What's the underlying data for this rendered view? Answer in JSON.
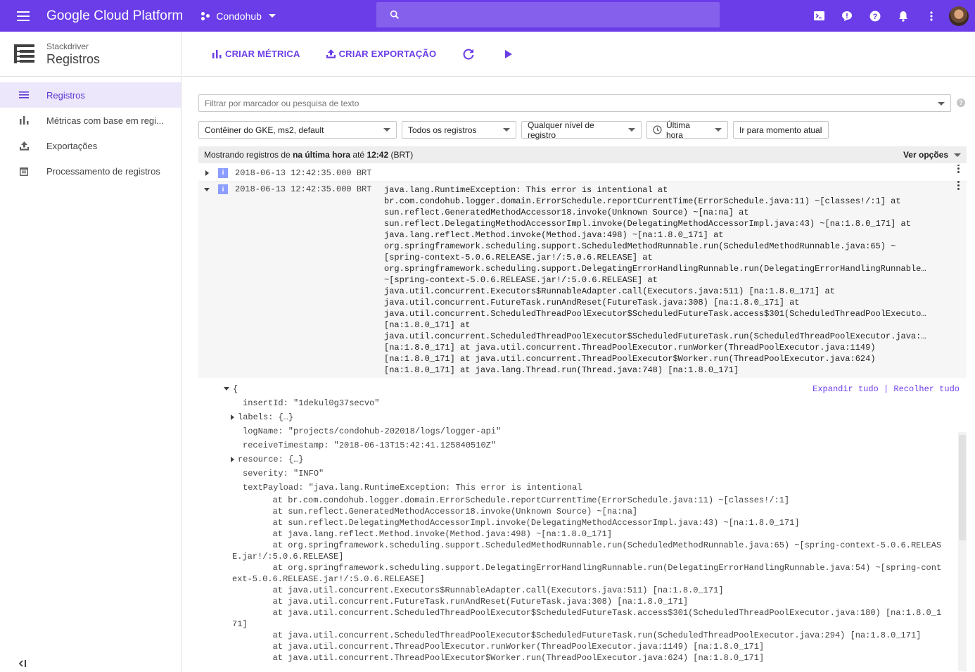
{
  "topbar": {
    "brand": "Google Cloud Platform",
    "project": "Condohub",
    "search_placeholder": ""
  },
  "sidebar": {
    "product": "Stackdriver",
    "section": "Registros",
    "items": [
      {
        "label": "Registros",
        "icon": "list-icon",
        "active": true
      },
      {
        "label": "Métricas com base em regi...",
        "icon": "bar-chart-icon",
        "active": false
      },
      {
        "label": "Exportações",
        "icon": "upload-icon",
        "active": false
      },
      {
        "label": "Processamento de registros",
        "icon": "calendar-icon",
        "active": false
      }
    ],
    "collapse_label": "<|"
  },
  "actions": {
    "create_metric": "CRIAR MÉTRICA",
    "create_export": "CRIAR EXPORTAÇÃO"
  },
  "filter": {
    "placeholder": "Filtrar por marcador ou pesquisa de texto",
    "resource": "Contêiner do GKE, ms2, default",
    "logs": "Todos os registros",
    "level": "Qualquer nível de registro",
    "time": "Última hora",
    "jump_now": "Ir para momento atual"
  },
  "status": {
    "prefix": "Mostrando registros de ",
    "range": "na última hora",
    "mid": " até ",
    "time": "12:42",
    "suffix": " (BRT)",
    "options": "Ver opções"
  },
  "entries": [
    {
      "severity": "i",
      "timestamp": "2018-06-13 12:42:35.000 BRT"
    },
    {
      "severity": "i",
      "timestamp": "2018-06-13 12:42:35.000 BRT",
      "message_lines": [
        "java.lang.RuntimeException: This error is intentional at",
        "br.com.condohub.logger.domain.ErrorSchedule.reportCurrentTime(ErrorSchedule.java:11) ~[classes!/:1] at",
        "sun.reflect.GeneratedMethodAccessor18.invoke(Unknown Source) ~[na:na] at",
        "sun.reflect.DelegatingMethodAccessorImpl.invoke(DelegatingMethodAccessorImpl.java:43) ~[na:1.8.0_171] at",
        "java.lang.reflect.Method.invoke(Method.java:498) ~[na:1.8.0_171] at",
        "org.springframework.scheduling.support.ScheduledMethodRunnable.run(ScheduledMethodRunnable.java:65) ~",
        "[spring-context-5.0.6.RELEASE.jar!/:5.0.6.RELEASE] at",
        "org.springframework.scheduling.support.DelegatingErrorHandlingRunnable.run(DelegatingErrorHandlingRunnable…",
        "~[spring-context-5.0.6.RELEASE.jar!/:5.0.6.RELEASE] at",
        "java.util.concurrent.Executors$RunnableAdapter.call(Executors.java:511) [na:1.8.0_171] at",
        "java.util.concurrent.FutureTask.runAndReset(FutureTask.java:308) [na:1.8.0_171] at",
        "java.util.concurrent.ScheduledThreadPoolExecutor$ScheduledFutureTask.access$301(ScheduledThreadPoolExecuto…",
        "[na:1.8.0_171] at",
        "java.util.concurrent.ScheduledThreadPoolExecutor$ScheduledFutureTask.run(ScheduledThreadPoolExecutor.java:…",
        "[na:1.8.0_171] at java.util.concurrent.ThreadPoolExecutor.runWorker(ThreadPoolExecutor.java:1149)",
        "[na:1.8.0_171] at java.util.concurrent.ThreadPoolExecutor$Worker.run(ThreadPoolExecutor.java:624)",
        "[na:1.8.0_171] at java.lang.Thread.run(Thread.java:748) [na:1.8.0_171]"
      ]
    }
  ],
  "json_view": {
    "open": "{",
    "expand_all": "Expandir tudo",
    "separator": "|",
    "collapse_all": "Recolher tudo",
    "insertId": "insertId: \"1dekul0g37secvo\"",
    "labels": "labels: {…}",
    "logName": "logName: \"projects/condohub-202018/logs/logger-api\"",
    "receiveTimestamp": "receiveTimestamp: \"2018-06-13T15:42:41.125840510Z\"",
    "resource": "resource: {…}",
    "severity": "severity: \"INFO\"",
    "textPayload": "textPayload: \"java.lang.RuntimeException: This error is intentional",
    "trace_lines": [
      "        at br.com.condohub.logger.domain.ErrorSchedule.reportCurrentTime(ErrorSchedule.java:11) ~[classes!/:1]",
      "        at sun.reflect.GeneratedMethodAccessor18.invoke(Unknown Source) ~[na:na]",
      "        at sun.reflect.DelegatingMethodAccessorImpl.invoke(DelegatingMethodAccessorImpl.java:43) ~[na:1.8.0_171]",
      "        at java.lang.reflect.Method.invoke(Method.java:498) ~[na:1.8.0_171]",
      "        at org.springframework.scheduling.support.ScheduledMethodRunnable.run(ScheduledMethodRunnable.java:65) ~[spring-context-5.0.6.RELEAS",
      "E.jar!/:5.0.6.RELEASE]",
      "        at org.springframework.scheduling.support.DelegatingErrorHandlingRunnable.run(DelegatingErrorHandlingRunnable.java:54) ~[spring-cont",
      "ext-5.0.6.RELEASE.jar!/:5.0.6.RELEASE]",
      "        at java.util.concurrent.Executors$RunnableAdapter.call(Executors.java:511) [na:1.8.0_171]",
      "        at java.util.concurrent.FutureTask.runAndReset(FutureTask.java:308) [na:1.8.0_171]",
      "        at java.util.concurrent.ScheduledThreadPoolExecutor$ScheduledFutureTask.access$301(ScheduledThreadPoolExecutor.java:180) [na:1.8.0_1",
      "71]",
      "        at java.util.concurrent.ScheduledThreadPoolExecutor$ScheduledFutureTask.run(ScheduledThreadPoolExecutor.java:294) [na:1.8.0_171]",
      "        at java.util.concurrent.ThreadPoolExecutor.runWorker(ThreadPoolExecutor.java:1149) [na:1.8.0_171]",
      "        at java.util.concurrent.ThreadPoolExecutor$Worker.run(ThreadPoolExecutor.java:624) [na:1.8.0_171]"
    ]
  },
  "colors": {
    "accent": "#6a3de8",
    "severity_info": "#8c9eff"
  }
}
